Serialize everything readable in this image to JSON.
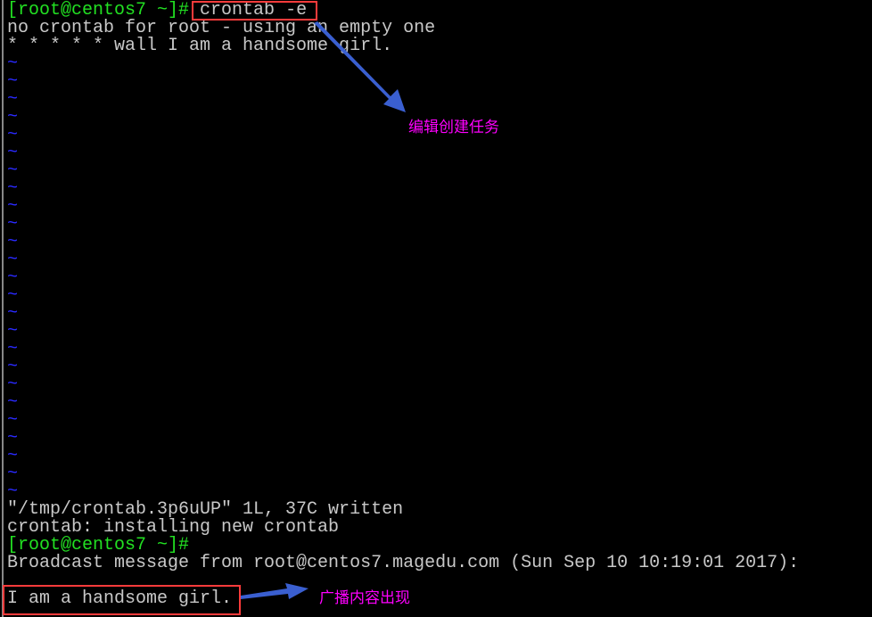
{
  "terminal": {
    "prompt": "[root@centos7 ~]#",
    "command": " crontab -e",
    "line_no_crontab": "no crontab for root - using an empty one",
    "line_cron_entry": "* * * * * wall I am a handsome girl.",
    "tilde": "~",
    "tilde_count": 25,
    "line_written": "\"/tmp/crontab.3p6uUP\" 1L, 37C written",
    "line_installing": "crontab: installing new crontab",
    "prompt2": "[root@centos7 ~]#",
    "line_broadcast": "Broadcast message from root@centos7.magedu.com (Sun Sep 10 10:19:01 2017):",
    "line_message": "I am a handsome girl."
  },
  "annotations": {
    "edit_note": "编辑创建任务",
    "broadcast_note": "广播内容出现",
    "arrow_color": "#3a5fd0",
    "box_color": "#ff3b3b",
    "note_color": "#ff00ff"
  }
}
